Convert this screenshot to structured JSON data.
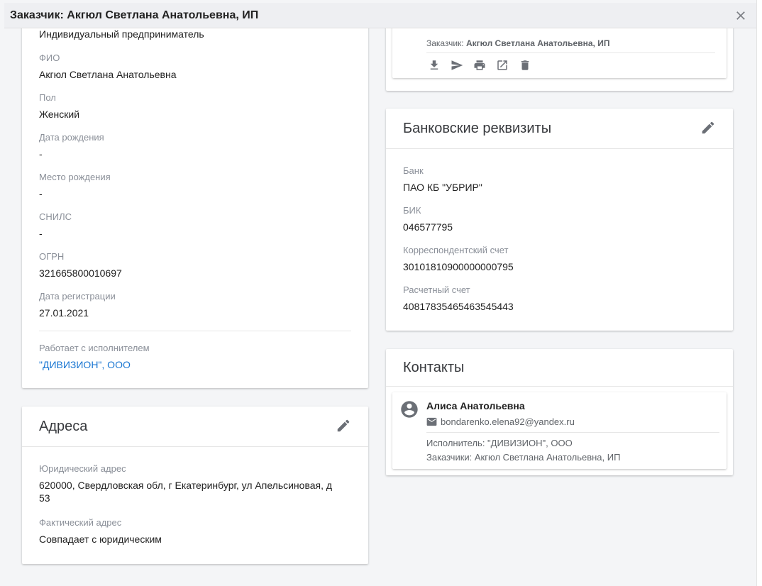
{
  "window": {
    "title": "Заказчик: Акгюл Светлана Анатольевна, ИП"
  },
  "individual": {
    "type_value": "Индивидуальный предприниматель",
    "fields": [
      {
        "label": "ФИО",
        "value": "Акгюл Светлана Анатольевна"
      },
      {
        "label": "Пол",
        "value": "Женский"
      },
      {
        "label": "Дата рождения",
        "value": "-"
      },
      {
        "label": "Место рождения",
        "value": "-"
      },
      {
        "label": "СНИЛС",
        "value": "-"
      },
      {
        "label": "ОГРН",
        "value": "321665800010697"
      },
      {
        "label": "Дата регистрации",
        "value": "27.01.2021"
      }
    ],
    "works_with": {
      "label": "Работает с исполнителем",
      "value": "\"ДИВИЗИОН\", ООО"
    }
  },
  "addresses": {
    "title": "Адреса",
    "legal": {
      "label": "Юридический адрес",
      "value_line1": "620000, Свердловская обл, г Екатеринбург, ул Апельсиновая, д",
      "value_line2": "53"
    },
    "actual": {
      "label": "Фактический адрес",
      "value": "Совпадает с юридическим"
    }
  },
  "document": {
    "customer_prefix": "Заказчик:",
    "customer_name": "Акгюл Светлана Анатольевна, ИП",
    "actions": [
      "download-icon",
      "send-icon",
      "print-icon",
      "open-external-icon",
      "delete-icon"
    ]
  },
  "bank": {
    "title": "Банковские реквизиты",
    "fields": [
      {
        "label": "Банк",
        "value": "ПАО КБ \"УБРИР\""
      },
      {
        "label": "БИК",
        "value": "046577795"
      },
      {
        "label": "Корреспондентский счет",
        "value": "30101810900000000795"
      },
      {
        "label": "Расчетный счет",
        "value": "40817835465463545443"
      }
    ]
  },
  "contacts": {
    "title": "Контакты",
    "items": [
      {
        "name": "Алиса Анатольевна",
        "email": "bondarenko.elena92@yandex.ru",
        "executor": "Исполнитель: \"ДИВИЗИОН\", ООО",
        "customers": "Заказчики: Акгюл Светлана Анатольевна, ИП"
      }
    ]
  },
  "colors": {
    "link": "#1976d2",
    "icon": "#6b6f76",
    "label": "#8a8f98",
    "background": "#f4f5f7"
  }
}
